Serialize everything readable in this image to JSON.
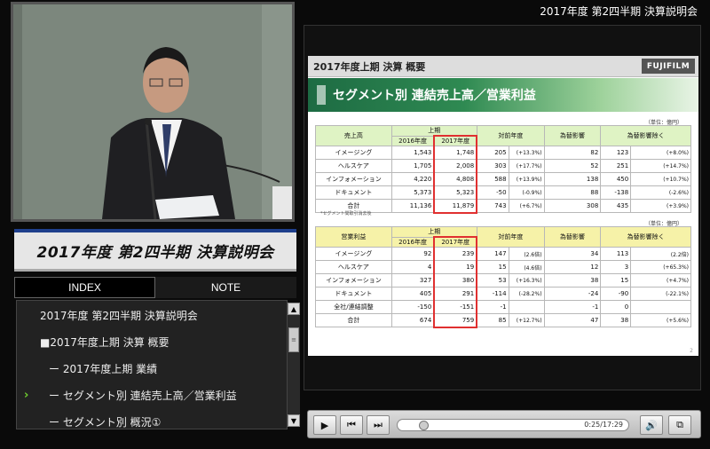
{
  "event_title": "2017年度 第2四半期 決算説明会",
  "banner_title": "2017年度 第2四半期 決算説明会",
  "tabs": {
    "index": "INDEX",
    "note": "NOTE"
  },
  "index_items": [
    {
      "label": "2017年度 第2四半期 決算説明会"
    },
    {
      "label": "■2017年度上期 決算 概要"
    },
    {
      "label": "ー 2017年度上期 業績"
    },
    {
      "label": "ー セグメント別 連結売上高／営業利益"
    },
    {
      "label": "ー セグメント別 概況①"
    }
  ],
  "current_index_marker": "›",
  "slide": {
    "header": "2017年度上期 決算 概要",
    "brand": "FUJIFILM",
    "title": "セグメント別 連結売上高／営業利益",
    "unit": "（単位：億円）",
    "note": "*セグメント間取引消去後",
    "page": "2",
    "table1": {
      "corner": "売上高",
      "period": "上期",
      "year_prev": "2016年度",
      "year_cur": "2017年度",
      "col_yoy": "対前年度",
      "col_fx": "為替影響",
      "col_exfx": "為替影響除く",
      "rows": [
        {
          "name": "イメージング",
          "prev": "1,543",
          "cur": "1,748",
          "diff": "205",
          "pct": "(+13.3%)",
          "fx": "82",
          "exfx": "123",
          "expct": "(+8.0%)"
        },
        {
          "name": "ヘルスケア",
          "prev": "1,705",
          "cur": "2,008",
          "diff": "303",
          "pct": "(+17.7%)",
          "fx": "52",
          "exfx": "251",
          "expct": "(+14.7%)"
        },
        {
          "name": "インフォメーション",
          "prev": "4,220",
          "cur": "4,808",
          "diff": "588",
          "pct": "(+13.9%)",
          "fx": "138",
          "exfx": "450",
          "expct": "(+10.7%)"
        },
        {
          "name": "ドキュメント",
          "prev": "5,373",
          "cur": "5,323",
          "diff": "-50",
          "pct": "(-0.9%)",
          "fx": "88",
          "exfx": "-138",
          "expct": "(-2.6%)"
        },
        {
          "name": "合計",
          "prev": "11,136",
          "cur": "11,879",
          "diff": "743",
          "pct": "(+6.7%)",
          "fx": "308",
          "exfx": "435",
          "expct": "(+3.9%)"
        }
      ]
    },
    "table2": {
      "corner": "営業利益",
      "period": "上期",
      "year_prev": "2016年度",
      "year_cur": "2017年度",
      "col_yoy": "対前年度",
      "col_fx": "為替影響",
      "col_exfx": "為替影響除く",
      "rows": [
        {
          "name": "イメージング",
          "prev": "92",
          "cur": "239",
          "diff": "147",
          "pct": "(2.6倍)",
          "fx": "34",
          "exfx": "113",
          "expct": "(2.2倍)"
        },
        {
          "name": "ヘルスケア",
          "prev": "4",
          "cur": "19",
          "diff": "15",
          "pct": "(4.6倍)",
          "fx": "12",
          "exfx": "3",
          "expct": "(+65.3%)"
        },
        {
          "name": "インフォメーション",
          "prev": "327",
          "cur": "380",
          "diff": "53",
          "pct": "(+16.3%)",
          "fx": "38",
          "exfx": "15",
          "expct": "(+4.7%)"
        },
        {
          "name": "ドキュメント",
          "prev": "405",
          "cur": "291",
          "diff": "-114",
          "pct": "(-28.2%)",
          "fx": "-24",
          "exfx": "-90",
          "expct": "(-22.1%)"
        },
        {
          "name": "全社/連結調整",
          "prev": "-150",
          "cur": "-151",
          "diff": "-1",
          "pct": "",
          "fx": "-1",
          "exfx": "0",
          "expct": ""
        },
        {
          "name": "合計",
          "prev": "674",
          "cur": "759",
          "diff": "85",
          "pct": "(+12.7%)",
          "fx": "47",
          "exfx": "38",
          "expct": "(+5.6%)"
        }
      ]
    }
  },
  "player": {
    "time": "0:25/17:29",
    "progress": 0.08,
    "icons": {
      "play": "play-icon",
      "prev": "previous-icon",
      "next": "next-icon",
      "volume": "volume-icon",
      "popout": "popout-icon"
    }
  }
}
